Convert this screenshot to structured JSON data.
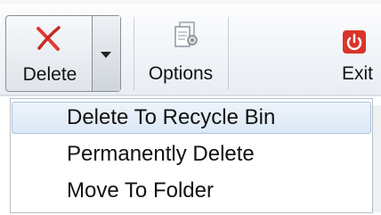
{
  "toolbar": {
    "delete_label": "Delete",
    "options_label": "Options",
    "exit_label": "Exit",
    "icons": {
      "delete": "delete-x-icon",
      "dropdown": "chevron-down-icon",
      "options": "options-icon",
      "exit": "power-icon"
    }
  },
  "menu": {
    "items": [
      {
        "label": "Delete To Recycle Bin",
        "highlighted": true
      },
      {
        "label": "Permanently Delete",
        "highlighted": false
      },
      {
        "label": "Move To Folder",
        "highlighted": false
      }
    ]
  },
  "colors": {
    "delete_icon": "#e03a2f",
    "exit_icon": "#d9342b",
    "highlight_bg": "#dce8f6",
    "highlight_border": "#a9c2e0"
  }
}
